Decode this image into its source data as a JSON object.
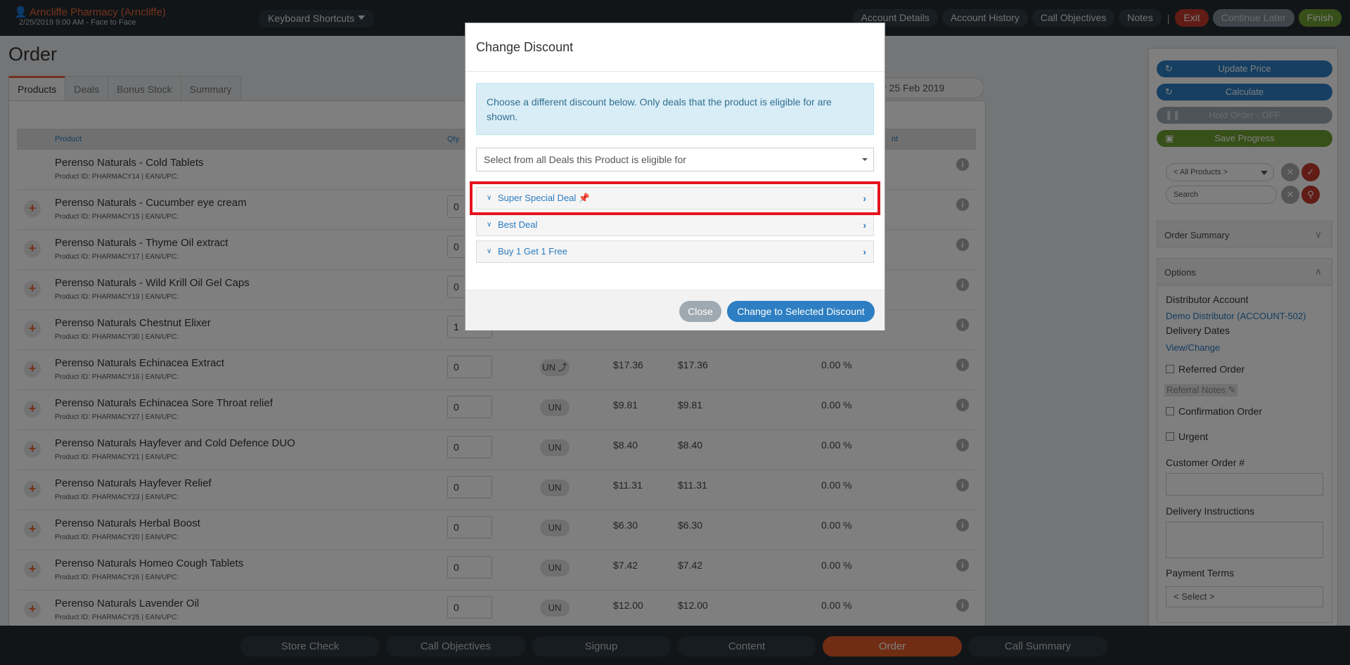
{
  "topbar": {
    "account_name": "Arncliffe Pharmacy (Arncliffe)",
    "account_sub": "2/25/2019 9:00 AM - Face to Face",
    "keyboard_shortcuts": "Keyboard Shortcuts",
    "nav": [
      "Account Details",
      "Account History",
      "Call Objectives",
      "Notes"
    ],
    "exit": "Exit",
    "continue_later": "Continue Later",
    "finish": "Finish"
  },
  "order": {
    "title": "Order",
    "tabs": [
      "Products",
      "Deals",
      "Bonus Stock",
      "Summary"
    ],
    "date": "r 25 Feb 2019",
    "columns": {
      "product": "Product",
      "qty": "Qty",
      "discount_tail": "nt"
    },
    "rows": [
      {
        "name": "Perenso Naturals - Cold Tablets",
        "id": "Product ID: PHARMACY14 | EAN/UPC:",
        "qty": "",
        "unit": "",
        "p1": "",
        "p2": "",
        "disc": ""
      },
      {
        "name": "Perenso Naturals - Cucumber eye cream",
        "id": "Product ID: PHARMACY15 | EAN/UPC:",
        "qty": "0",
        "unit": "",
        "p1": "",
        "p2": "",
        "disc": ""
      },
      {
        "name": "Perenso Naturals - Thyme Oil extract",
        "id": "Product ID: PHARMACY17 | EAN/UPC:",
        "qty": "0",
        "unit": "",
        "p1": "",
        "p2": "",
        "disc": ""
      },
      {
        "name": "Perenso Naturals - Wild Krill Oil Gel Caps",
        "id": "Product ID: PHARMACY19 | EAN/UPC:",
        "qty": "0",
        "unit": "",
        "p1": "",
        "p2": "",
        "disc": ""
      },
      {
        "name": "Perenso Naturals Chestnut Elixer",
        "id": "Product ID: PHARMACY30 | EAN/UPC:",
        "qty": "1",
        "unit": "",
        "p1": "",
        "p2": "",
        "disc": ""
      },
      {
        "name": "Perenso Naturals Echinacea Extract",
        "id": "Product ID: PHARMACY16 | EAN/UPC:",
        "qty": "0",
        "unit": "UN ⤴",
        "p1": "$17.36",
        "p2": "$17.36",
        "disc": "0.00 %"
      },
      {
        "name": "Perenso Naturals Echinacea Sore Throat relief",
        "id": "Product ID: PHARMACY27 | EAN/UPC:",
        "qty": "0",
        "unit": "UN",
        "p1": "$9.81",
        "p2": "$9.81",
        "disc": "0.00 %"
      },
      {
        "name": "Perenso Naturals Hayfever and Cold Defence DUO",
        "id": "Product ID: PHARMACY21 | EAN/UPC:",
        "qty": "0",
        "unit": "UN",
        "p1": "$8.40",
        "p2": "$8.40",
        "disc": "0.00 %"
      },
      {
        "name": "Perenso Naturals Hayfever Relief",
        "id": "Product ID: PHARMACY23 | EAN/UPC:",
        "qty": "0",
        "unit": "UN",
        "p1": "$11.31",
        "p2": "$11.31",
        "disc": "0.00 %"
      },
      {
        "name": "Perenso Naturals Herbal Boost",
        "id": "Product ID: PHARMACY20 | EAN/UPC:",
        "qty": "0",
        "unit": "UN",
        "p1": "$6.30",
        "p2": "$6.30",
        "disc": "0.00 %"
      },
      {
        "name": "Perenso Naturals Homeo Cough Tablets",
        "id": "Product ID: PHARMACY26 | EAN/UPC:",
        "qty": "0",
        "unit": "UN",
        "p1": "$7.42",
        "p2": "$7.42",
        "disc": "0.00 %"
      },
      {
        "name": "Perenso Naturals Lavender Oil",
        "id": "Product ID: PHARMACY25 | EAN/UPC:",
        "qty": "0",
        "unit": "UN",
        "p1": "$12.00",
        "p2": "$12.00",
        "disc": "0.00 %"
      }
    ]
  },
  "sidebar": {
    "update_price": "Update Price",
    "calculate": "Calculate",
    "hold_order": "Hold Order - OFF",
    "save_progress": "Save Progress",
    "filter": "< All Products >",
    "search_placeholder": "Search",
    "order_summary": "Order Summary",
    "options": "Options",
    "distributor_label": "Distributor Account",
    "distributor_value": "Demo Distributor (ACCOUNT-502)",
    "delivery_label": "Delivery Dates",
    "delivery_link": "View/Change",
    "referred_order": "Referred Order",
    "referral_notes": "Referral Notes",
    "confirmation_order": "Confirmation Order",
    "urgent": "Urgent",
    "customer_order": "Customer Order #",
    "delivery_instructions": "Delivery Instructions",
    "payment_terms": "Payment Terms",
    "payment_select": "< Select >"
  },
  "bottom_nav": [
    "Store Check",
    "Call Objectives",
    "Signup",
    "Content",
    "Order",
    "Call Summary"
  ],
  "modal": {
    "title": "Change Discount",
    "info": "Choose a different discount below. Only deals that the product is eligible for are shown.",
    "select_placeholder": "Select from all Deals this Product is eligible for",
    "deals": [
      "Super Special Deal",
      "Best Deal",
      "Buy 1 Get 1 Free"
    ],
    "close": "Close",
    "change": "Change to Selected Discount"
  },
  "colors": {
    "accent_orange": "#e8663a",
    "primary_blue": "#2d7ec2",
    "highlight_red": "#e3141f",
    "finish_green": "#6f9f30"
  }
}
